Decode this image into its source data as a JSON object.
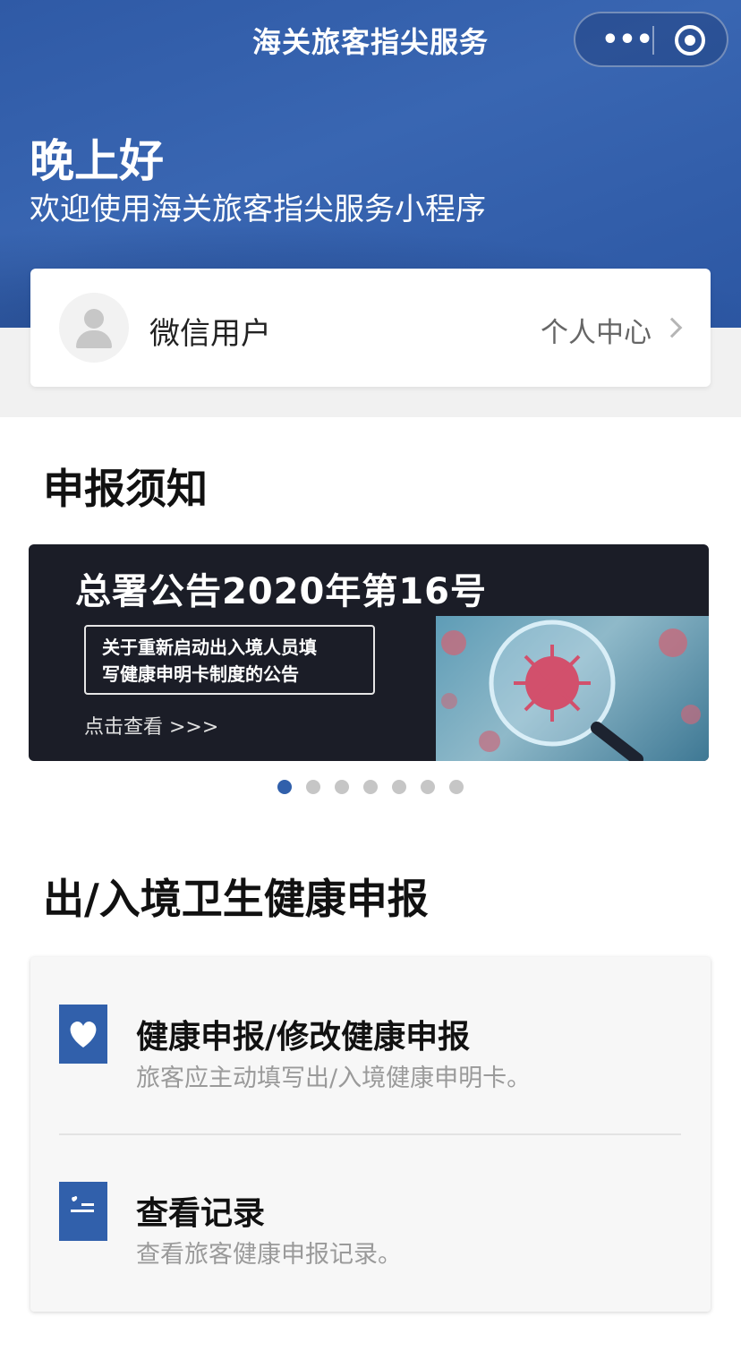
{
  "header": {
    "title": "海关旅客指尖服务",
    "menu_icon": "more-dots-icon",
    "close_icon": "target-circle-icon",
    "menu_glyph": "•••"
  },
  "greeting": {
    "title": "晚上好",
    "subtitle": "欢迎使用海关旅客指尖服务小程序"
  },
  "user": {
    "name": "微信用户",
    "profile_link": "个人中心",
    "avatar_icon": "user-placeholder-icon"
  },
  "notice_section": {
    "title": "申报须知"
  },
  "banner": {
    "title": "总署公告2020年第16号",
    "box_line1": "关于重新启动出入境人员填",
    "box_line2": "写健康申明卡制度的公告",
    "link": "点击查看 >>>",
    "image_icon": "virus-magnifier-image",
    "slide_count": 7,
    "active_slide": 1
  },
  "health_section": {
    "title": "出/入境卫生健康申报"
  },
  "services": [
    {
      "title": "健康申报/修改健康申报",
      "subtitle": "旅客应主动填写出/入境健康申明卡。",
      "icon": "heart-icon"
    },
    {
      "title": "查看记录",
      "subtitle": "查看旅客健康申报记录。",
      "icon": "record-list-icon"
    }
  ],
  "colors": {
    "brand_blue": "#3160ab",
    "banner_bg": "#1b1d27",
    "inactive_dot": "#c6c6c6"
  }
}
